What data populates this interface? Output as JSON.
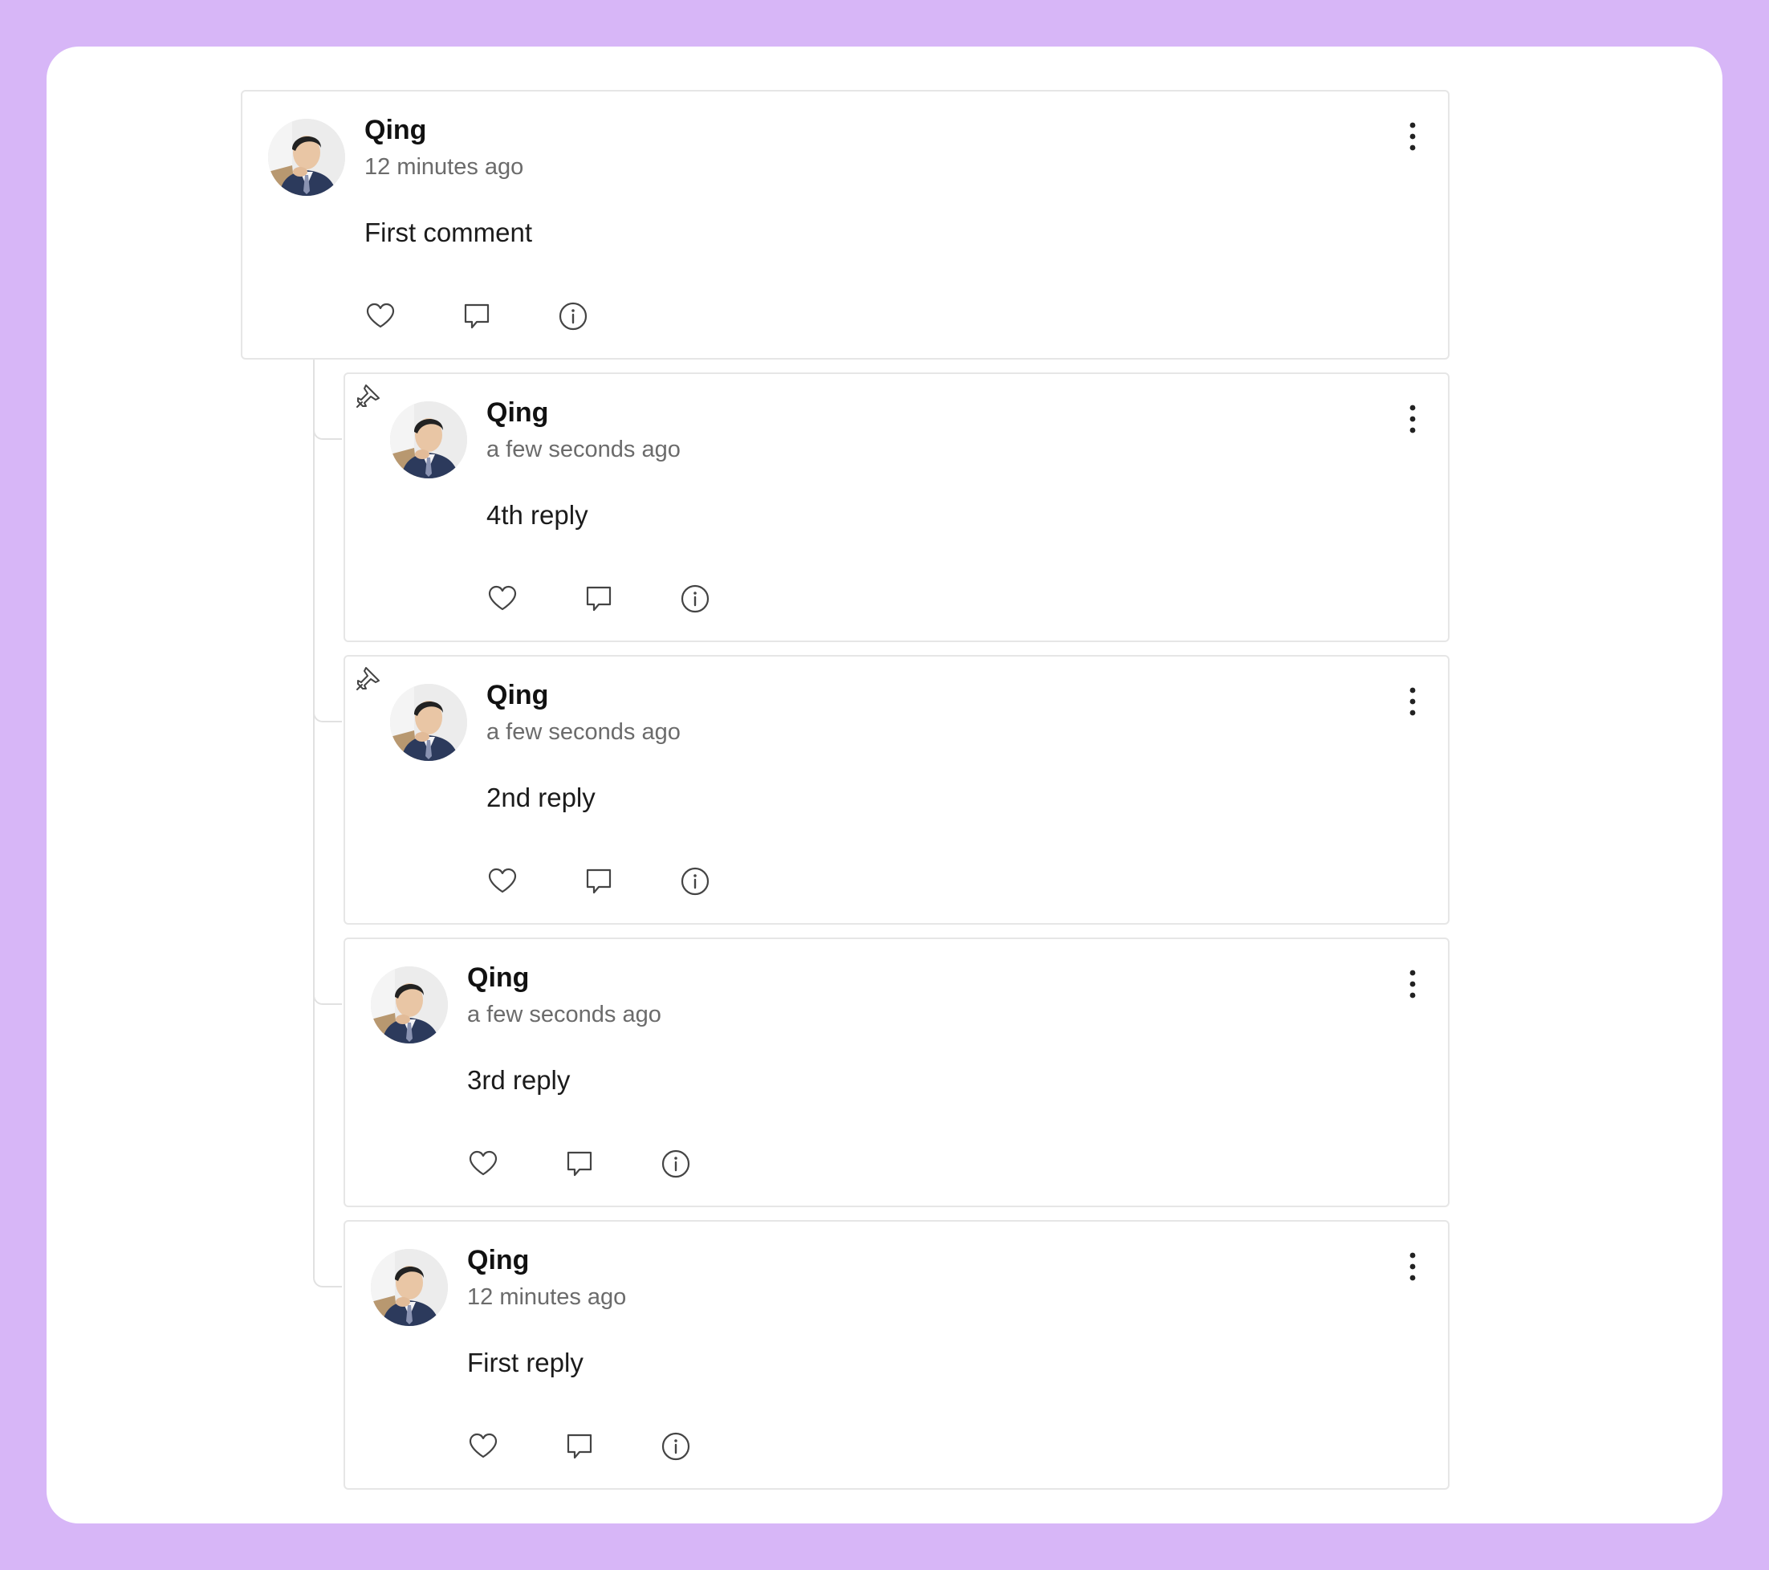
{
  "comments": [
    {
      "author": "Qing",
      "time": "12 minutes ago",
      "text": "First comment"
    },
    {
      "author": "Qing",
      "time": "a few seconds ago",
      "text": "4th reply",
      "pinned": true
    },
    {
      "author": "Qing",
      "time": "a few seconds ago",
      "text": "2nd reply",
      "pinned": true
    },
    {
      "author": "Qing",
      "time": "a few seconds ago",
      "text": "3rd reply",
      "pinned": false
    },
    {
      "author": "Qing",
      "time": "12 minutes ago",
      "text": "First reply",
      "pinned": false
    }
  ],
  "icons": {
    "like": "heart-icon",
    "reply": "comment-icon",
    "info": "info-icon",
    "more": "more-vertical-icon",
    "pin": "pin-icon"
  },
  "colors": {
    "background": "#d7b6f7",
    "panel": "#ffffff",
    "card_border": "#e6e6e6",
    "text": "#111111",
    "muted": "#6b6b6b"
  }
}
